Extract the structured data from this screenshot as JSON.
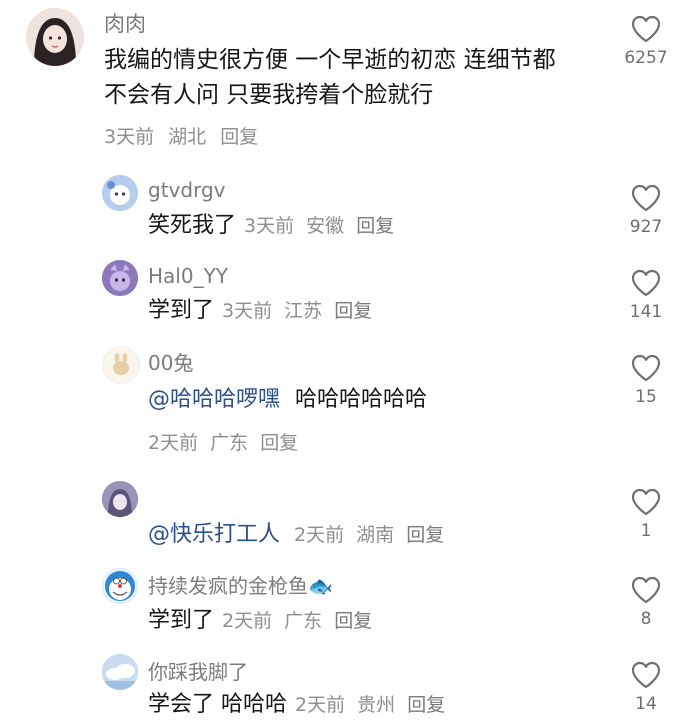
{
  "comments": [
    {
      "username": "肉肉",
      "text": "我编的情史很方便 一个早逝的初恋 连细节都",
      "text2": "不会有人问 只要我挎着个脸就行",
      "time": "3天前",
      "location": "湖北",
      "reply_label": "回复",
      "likes": "6257"
    },
    {
      "username": "gtvdrgv",
      "text": "笑死我了",
      "time": "3天前",
      "location": "安徽",
      "reply_label": "回复",
      "likes": "927"
    },
    {
      "username": "Hal0_YY",
      "text": "学到了",
      "time": "3天前",
      "location": "江苏",
      "reply_label": "回复",
      "likes": "141"
    },
    {
      "username": "00兔",
      "mention": "@哈哈哈啰嘿",
      "text": "哈哈哈哈哈哈",
      "time": "2天前",
      "location": "广东",
      "reply_label": "回复",
      "likes": "15"
    },
    {
      "username": "",
      "mention": "@快乐打工人",
      "time": "2天前",
      "location": "湖南",
      "reply_label": "回复",
      "likes": "1"
    },
    {
      "username": "持续发疯的金枪鱼🐟",
      "text": "学到了",
      "time": "2天前",
      "location": "广东",
      "reply_label": "回复",
      "likes": "8"
    },
    {
      "username": "你踩我脚了",
      "text": "学会了 哈哈哈",
      "time": "2天前",
      "location": "贵州",
      "reply_label": "回复",
      "likes": "14"
    }
  ],
  "icons": {
    "like": "heart-outline-icon"
  },
  "colors": {
    "mention": "#2a4f8c",
    "meta": "#8e8e8e"
  }
}
